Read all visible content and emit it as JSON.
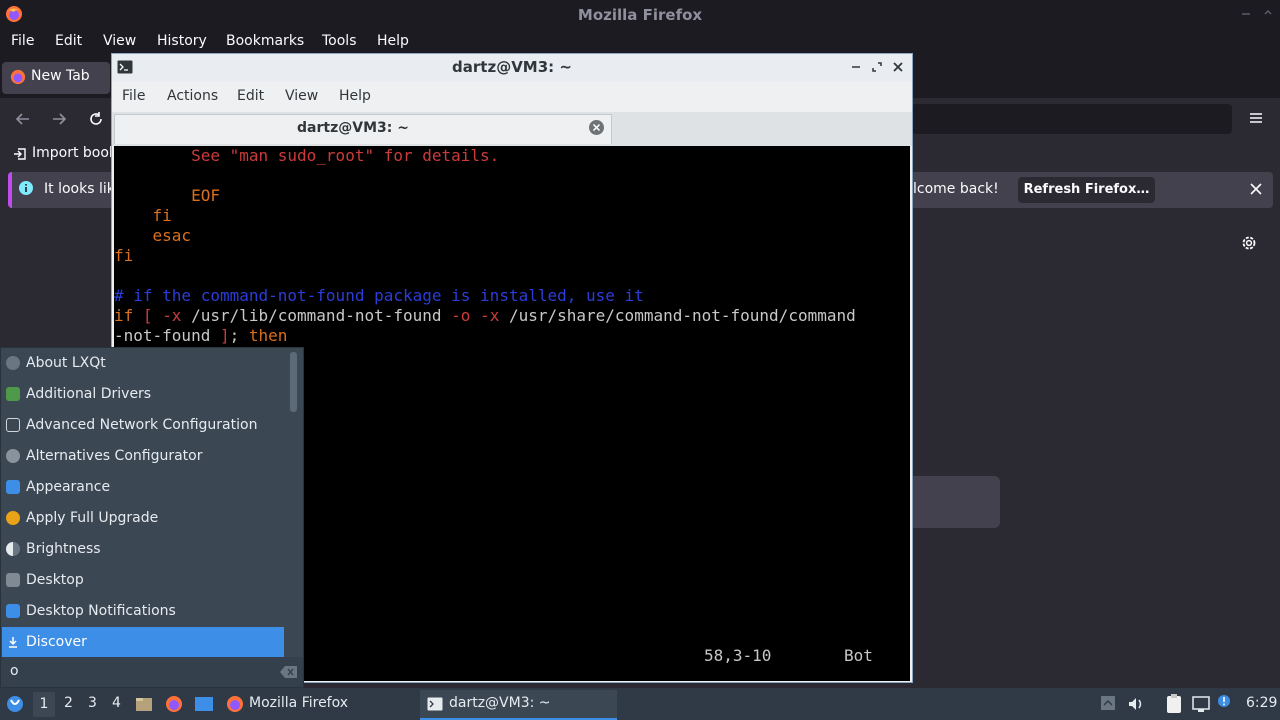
{
  "firefox": {
    "window_title": "Mozilla Firefox",
    "menu": [
      "File",
      "Edit",
      "View",
      "History",
      "Bookmarks",
      "Tools",
      "Help"
    ],
    "tab_label": "New Tab",
    "bookmark_label": "Import book",
    "notification_text": "It looks lik",
    "notification_suffix": "lcome back!",
    "refresh_button": "Refresh Firefox…"
  },
  "terminal": {
    "window_title": "dartz@VM3: ~",
    "menu": [
      "File",
      "Actions",
      "Edit",
      "View",
      "Help"
    ],
    "tab_title": "dartz@VM3: ~",
    "status_position": "58,3-10",
    "status_scroll": "Bot",
    "colors": {
      "red": "#cc3b3b",
      "orange": "#d9701e",
      "blue": "#2b3dd9",
      "grey": "#c8c8c8"
    }
  },
  "start_menu": {
    "items": [
      {
        "label": "About LXQt",
        "icon": "info-icon"
      },
      {
        "label": "Additional Drivers",
        "icon": "chip-icon"
      },
      {
        "label": "Advanced Network Configuration",
        "icon": "network-icon"
      },
      {
        "label": "Alternatives Configurator",
        "icon": "gear-icon"
      },
      {
        "label": "Appearance",
        "icon": "monitor-icon"
      },
      {
        "label": "Apply Full Upgrade",
        "icon": "upgrade-icon"
      },
      {
        "label": "Brightness",
        "icon": "brightness-icon"
      },
      {
        "label": "Desktop",
        "icon": "desktop-icon"
      },
      {
        "label": "Desktop Notifications",
        "icon": "notification-icon"
      },
      {
        "label": "Discover",
        "icon": "download-icon"
      }
    ],
    "search_value": "o"
  },
  "taskbar": {
    "workspaces": [
      "1",
      "2",
      "3",
      "4"
    ],
    "tasks": [
      "Mozilla Firefox",
      "dartz@VM3: ~"
    ],
    "clock": "6:29"
  }
}
